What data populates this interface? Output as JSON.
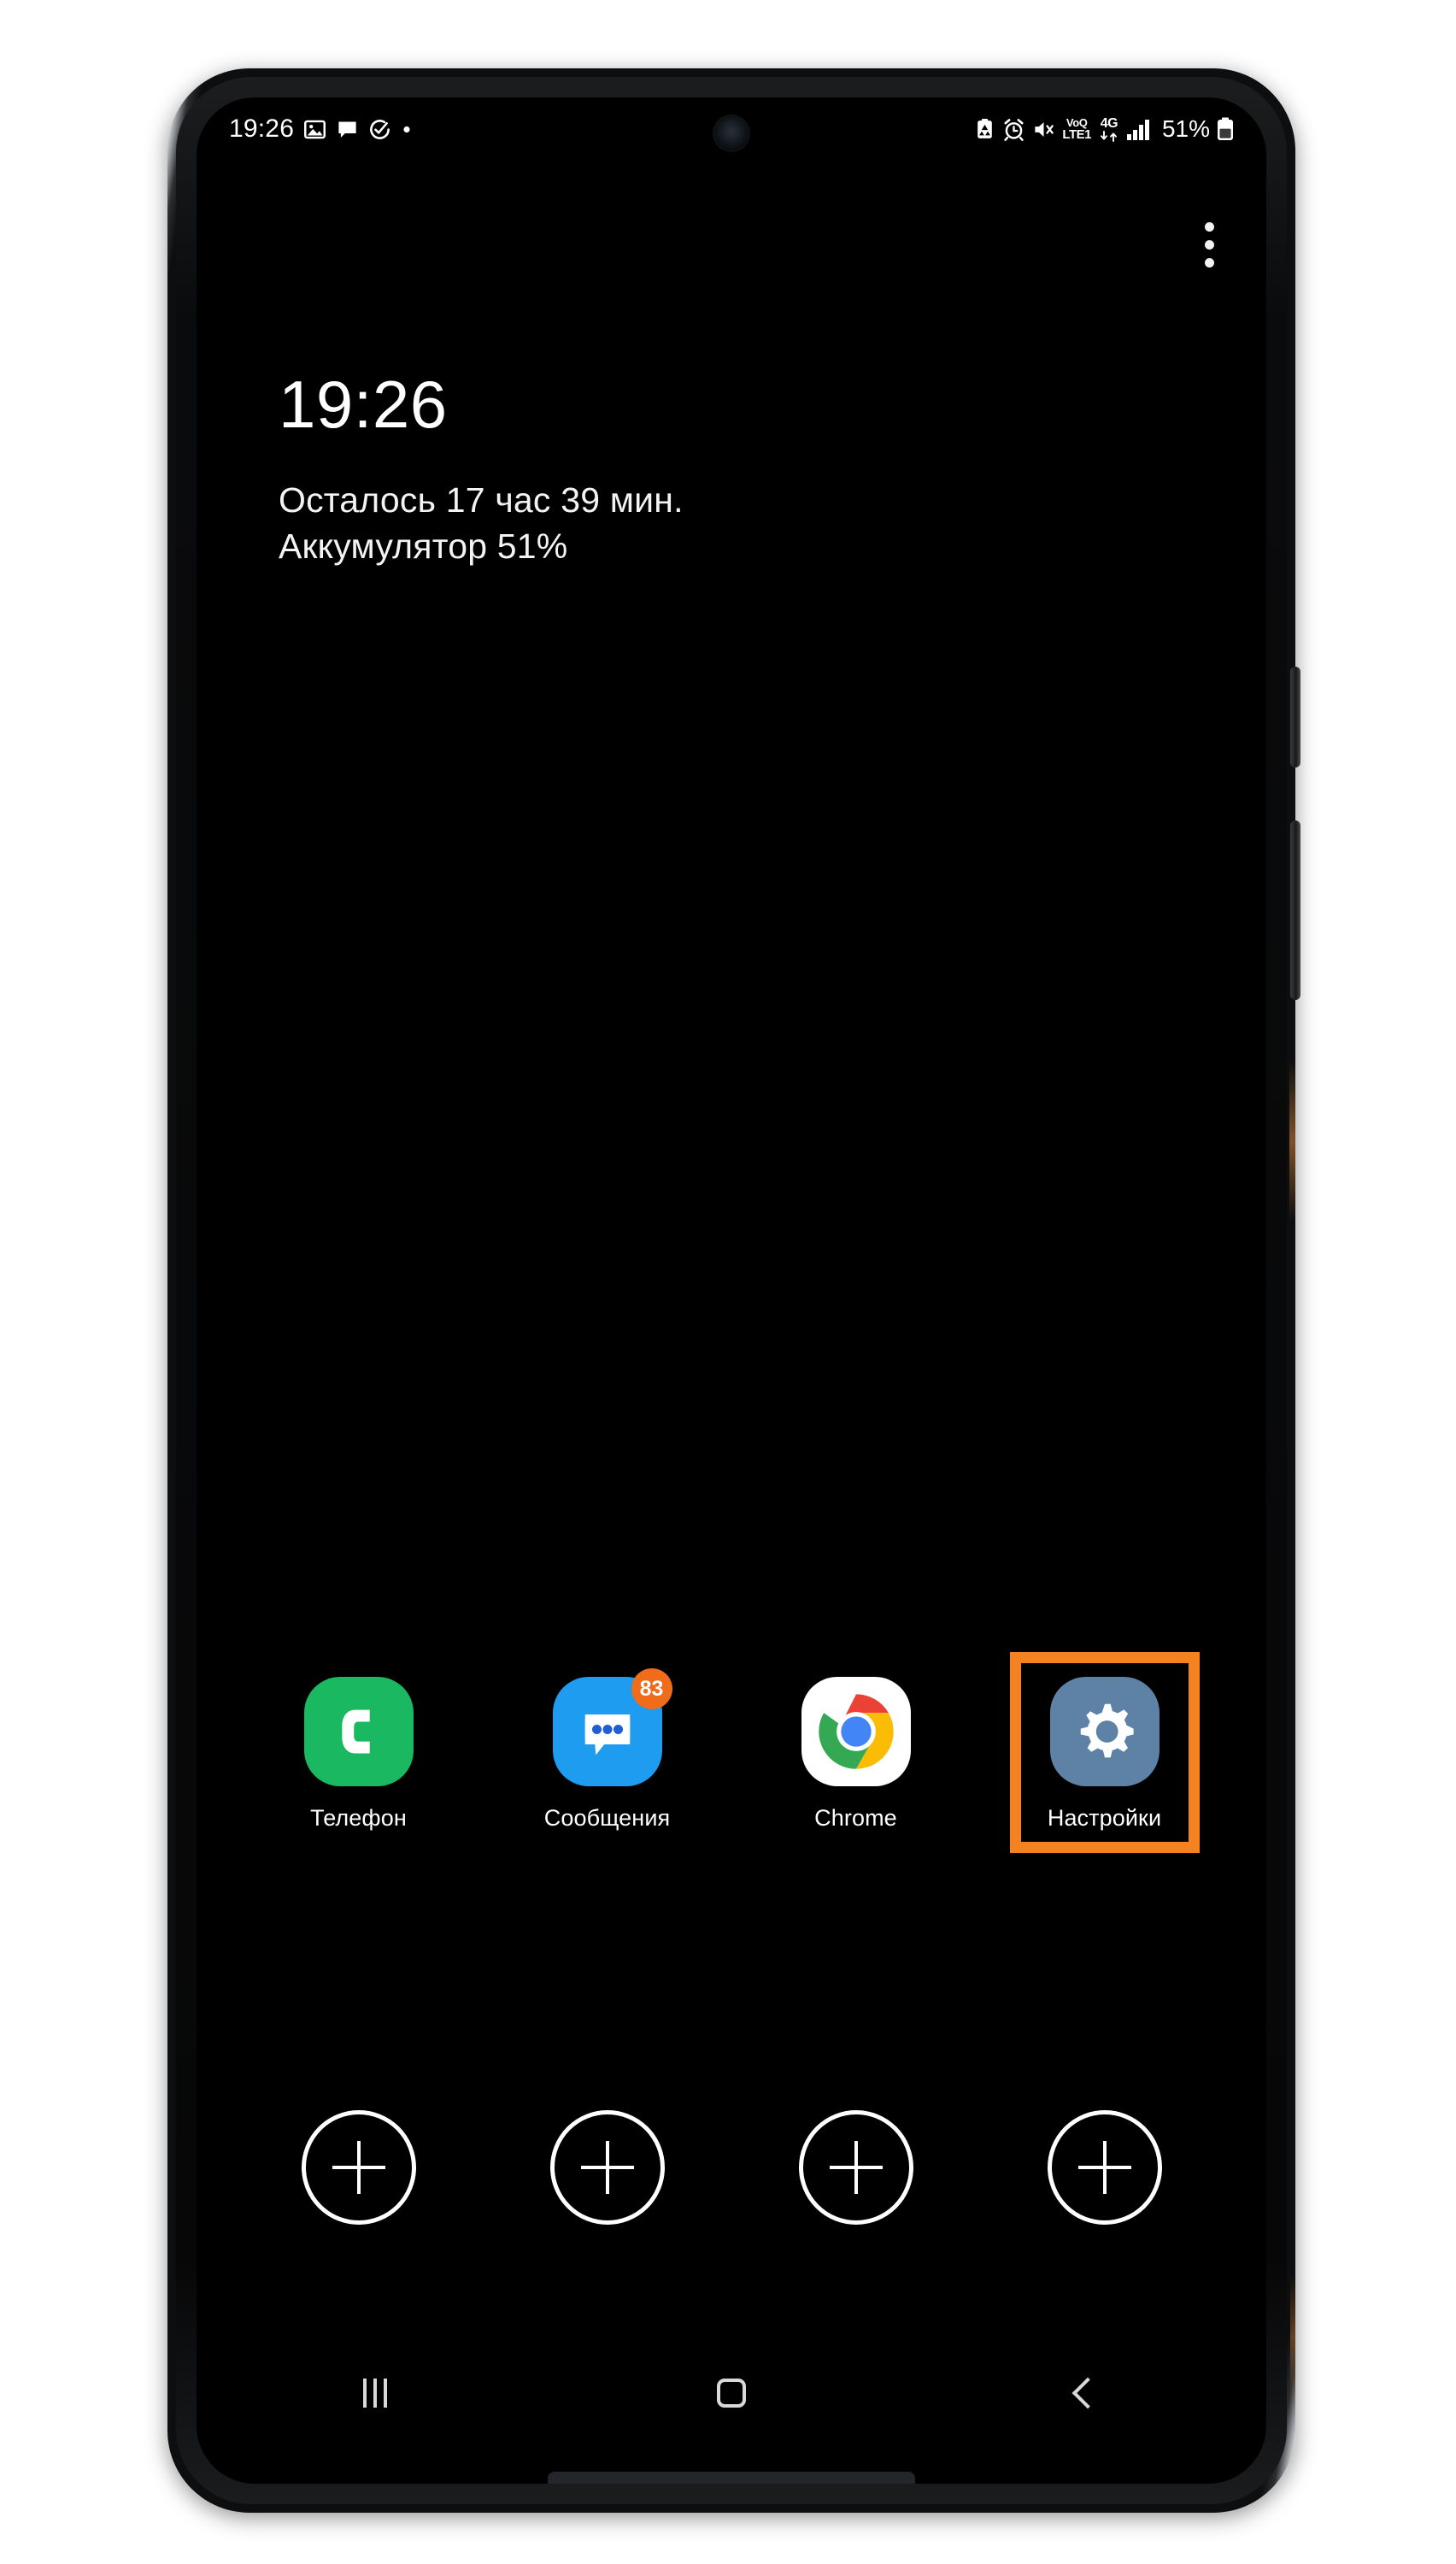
{
  "device": {
    "name": "samsung-galaxy-phone",
    "screen_background": "#000000",
    "frame_color": "#0d0e0f"
  },
  "status_bar": {
    "clock": "19:26",
    "left_icons": [
      {
        "name": "gallery-icon",
        "label": "image"
      },
      {
        "name": "message-icon",
        "label": "sms"
      },
      {
        "name": "check-circle-icon",
        "label": "task"
      },
      {
        "name": "more-dot-icon",
        "label": "more"
      }
    ],
    "right_icons": [
      {
        "name": "data-saver-icon",
        "label": "data saver"
      },
      {
        "name": "alarm-icon",
        "label": "alarm"
      },
      {
        "name": "mute-icon",
        "label": "sound off"
      }
    ],
    "network": {
      "volte_top": "VoQ",
      "volte_bottom": "LTE1",
      "generation": "4G",
      "signal_bars": 3,
      "signal_bars_total": 4
    },
    "battery_percent": "51%",
    "battery_level": 51
  },
  "overflow": {
    "name": "Home screen options",
    "dots": 3
  },
  "aod": {
    "clock": "19:26",
    "line1": "Осталось 17 час 39 мин.",
    "line2": "Аккумулятор 51%"
  },
  "apps": [
    {
      "id": "phone",
      "label": "Телефон",
      "icon": "phone-icon",
      "bg": "#1BB862",
      "badge": null,
      "highlighted": false
    },
    {
      "id": "messages",
      "label": "Сообщения",
      "icon": "messages-icon",
      "bg": "#1D9CF0",
      "badge": "83",
      "badge_color": "#ef6c1a",
      "highlighted": false
    },
    {
      "id": "chrome",
      "label": "Chrome",
      "icon": "chrome-icon",
      "bg": "#FFFFFF",
      "badge": null,
      "highlighted": false
    },
    {
      "id": "settings",
      "label": "Настройки",
      "icon": "gear-icon",
      "bg": "#5E82A6",
      "badge": null,
      "highlighted": true,
      "highlight_color": "#f58220"
    }
  ],
  "empty_slots": [
    {
      "id": "empty-slot-1",
      "icon": "plus-icon"
    },
    {
      "id": "empty-slot-2",
      "icon": "plus-icon"
    },
    {
      "id": "empty-slot-3",
      "icon": "plus-icon"
    },
    {
      "id": "empty-slot-4",
      "icon": "plus-icon"
    }
  ],
  "nav_bar": {
    "recents": "Недавние",
    "home": "Главный экран",
    "back": "Назад"
  }
}
